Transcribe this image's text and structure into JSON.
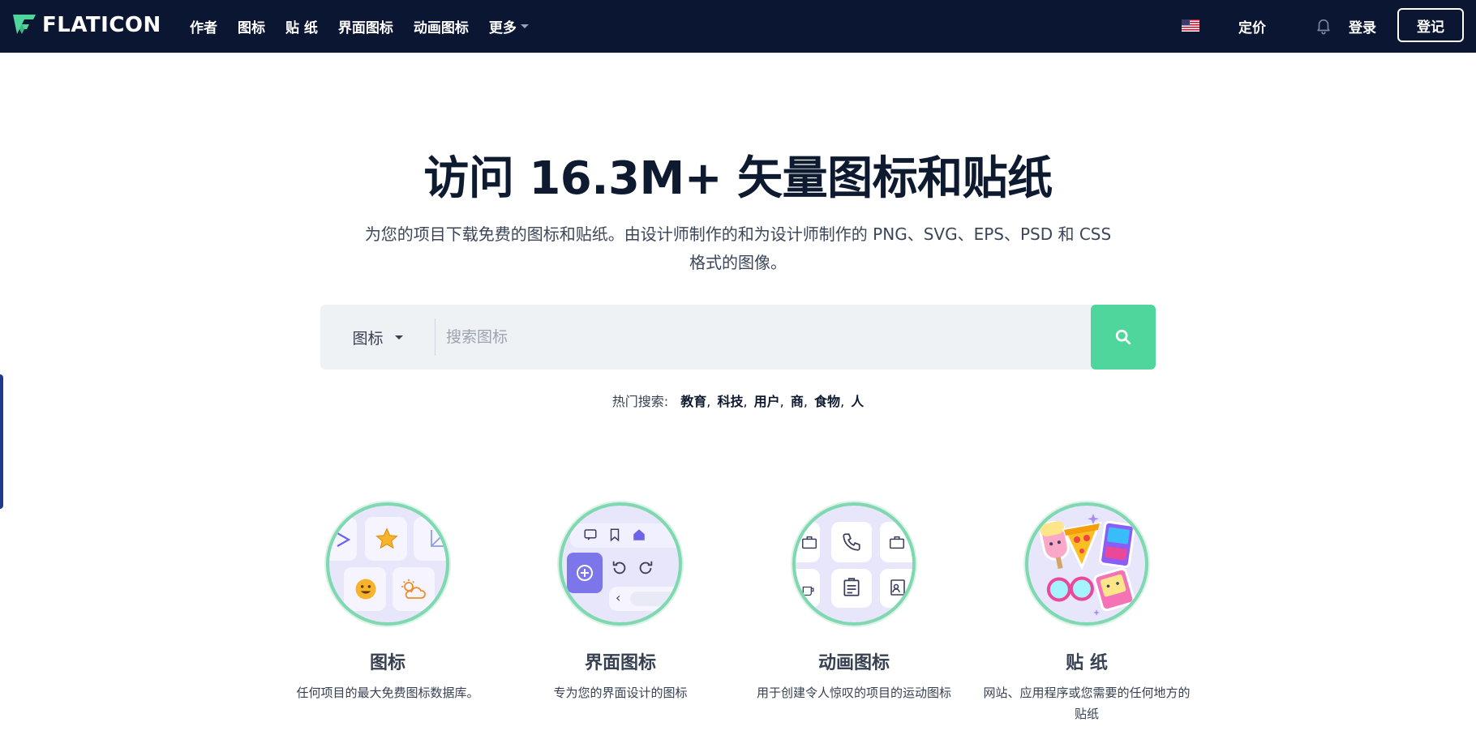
{
  "nav": {
    "logo_text": "FLATICON",
    "links": [
      "作者",
      "图标",
      "贴 纸",
      "界面图标",
      "动画图标",
      "更多"
    ],
    "pricing": "定价",
    "login": "登录",
    "signup": "登记"
  },
  "hero": {
    "title": "访问 16.3M+ 矢量图标和贴纸",
    "subtitle": "为您的项目下载免费的图标和贴纸。由设计师制作的和为设计师制作的 PNG、SVG、EPS、PSD 和 CSS 格式的图像。"
  },
  "search": {
    "type_label": "图标",
    "placeholder": "搜索图标"
  },
  "popular": {
    "label": "热门搜索:",
    "terms": [
      "教育",
      "科技",
      "用户",
      "商",
      "食物",
      "人"
    ]
  },
  "categories": [
    {
      "title": "图标",
      "desc": "任何项目的最大免费图标数据库。"
    },
    {
      "title": "界面图标",
      "desc": "专为您的界面设计的图标"
    },
    {
      "title": "动画图标",
      "desc": "用于创建令人惊叹的项目的运动图标"
    },
    {
      "title": "贴 纸",
      "desc": "网站、应用程序或您需要的任何地方的贴纸"
    }
  ],
  "colors": {
    "navbar_bg": "#0b1632",
    "search_button": "#4fd69c",
    "circle_border": "#7fd8b0",
    "circle_bg": "#e7e6fb"
  }
}
